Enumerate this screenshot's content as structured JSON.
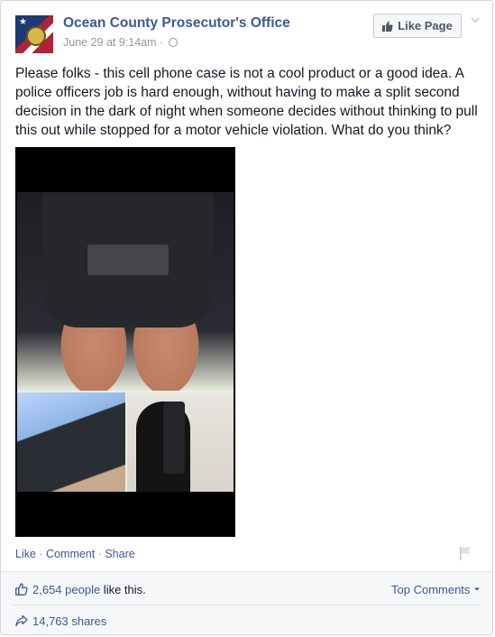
{
  "post": {
    "page_name": "Ocean County Prosecutor's Office",
    "timestamp": "June 29 at 9:14am",
    "meta_sep": " · ",
    "like_page_label": "Like Page",
    "text": "Please folks - this cell phone case is not a cool product or a good idea. A police officers job is hard enough, without having to make a split second decision in the dark of night when someone decides without thinking to pull this out while stopped for a motor vehicle violation. What do you think?"
  },
  "actions": {
    "like": "Like",
    "comment": "Comment",
    "share": "Share",
    "separator": " · "
  },
  "ufi": {
    "likes_count": "2,654 people",
    "likes_suffix": " like this.",
    "top_comments": "Top Comments",
    "shares": "14,763 shares"
  },
  "icons": {
    "like_page": "thumbs-up-icon",
    "privacy": "globe-icon",
    "menu": "chevron-down-icon",
    "report": "flag-icon",
    "likes": "thumbs-up-outline-icon",
    "shares": "share-arrow-icon"
  },
  "colors": {
    "link": "#3b5998",
    "meta": "#9197a3",
    "text": "#141823"
  }
}
